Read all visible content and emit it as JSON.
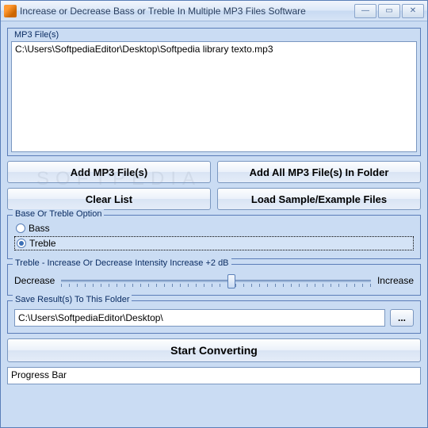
{
  "window": {
    "title": "Increase or Decrease Bass or Treble In Multiple MP3 Files Software"
  },
  "filelist": {
    "legend": "MP3 File(s)",
    "items": [
      "C:\\Users\\SoftpediaEditor\\Desktop\\Softpedia library texto.mp3"
    ]
  },
  "buttons": {
    "add_files": "Add MP3 File(s)",
    "add_folder": "Add All MP3 File(s) In Folder",
    "clear": "Clear List",
    "load_sample": "Load Sample/Example Files",
    "browse": "...",
    "start": "Start Converting"
  },
  "option_group": {
    "legend": "Base Or Treble Option",
    "bass": "Bass",
    "treble": "Treble",
    "selected": "treble"
  },
  "intensity": {
    "legend": "Treble - Increase Or Decrease Intensity Increase +2 dB",
    "decrease": "Decrease",
    "increase": "Increase",
    "slider_percent": 55
  },
  "save": {
    "legend": "Save Result(s) To This Folder",
    "path": "C:\\Users\\SoftpediaEditor\\Desktop\\"
  },
  "progress": {
    "label": "Progress Bar"
  },
  "watermark": "SOFTPEDIA"
}
